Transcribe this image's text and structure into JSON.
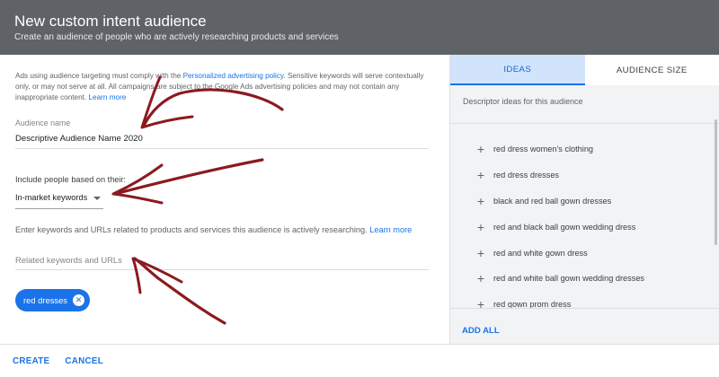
{
  "header": {
    "title": "New custom intent audience",
    "subtitle": "Create an audience of people who are actively researching products and services"
  },
  "policy": {
    "text_before": "Ads using audience targeting must comply with the ",
    "link": "Personalized advertising policy",
    "text_after": ". Sensitive keywords will serve contextually only, or may not serve at all. All campaigns are subject to the Google Ads advertising policies and may not contain any inappropriate content. ",
    "learn_more": "Learn more"
  },
  "audience_name": {
    "label": "Audience name",
    "value": "Descriptive Audience Name 2020"
  },
  "include": {
    "label": "Include people based on their:",
    "selected": "In-market keywords"
  },
  "instructions": {
    "text": "Enter keywords and URLs related to products and services this audience is actively researching. ",
    "learn_more": "Learn more"
  },
  "keywords_input": {
    "placeholder": "Related keywords and URLs",
    "value": ""
  },
  "chips": [
    {
      "label": "red dresses"
    }
  ],
  "sidebar": {
    "tabs": [
      {
        "label": "IDEAS",
        "active": true
      },
      {
        "label": "AUDIENCE SIZE",
        "active": false
      }
    ],
    "descriptor": "Descriptor ideas for this audience",
    "ideas": [
      {
        "label": "red dress women's clothing"
      },
      {
        "label": "red dress dresses"
      },
      {
        "label": "black and red ball gown dresses"
      },
      {
        "label": "red and black ball gown wedding dress"
      },
      {
        "label": "red and white gown dress"
      },
      {
        "label": "red and white ball gown wedding dresses"
      },
      {
        "label": "red gown prom dress"
      }
    ],
    "add_all": "ADD ALL"
  },
  "footer": {
    "create": "CREATE",
    "cancel": "CANCEL"
  },
  "colors": {
    "header_bg": "#5f6368",
    "accent": "#1a73e8",
    "tab_active_bg": "#d2e3fc",
    "panel_bg": "#f1f3f4",
    "annotation_arrow": "#8b1a1f"
  }
}
